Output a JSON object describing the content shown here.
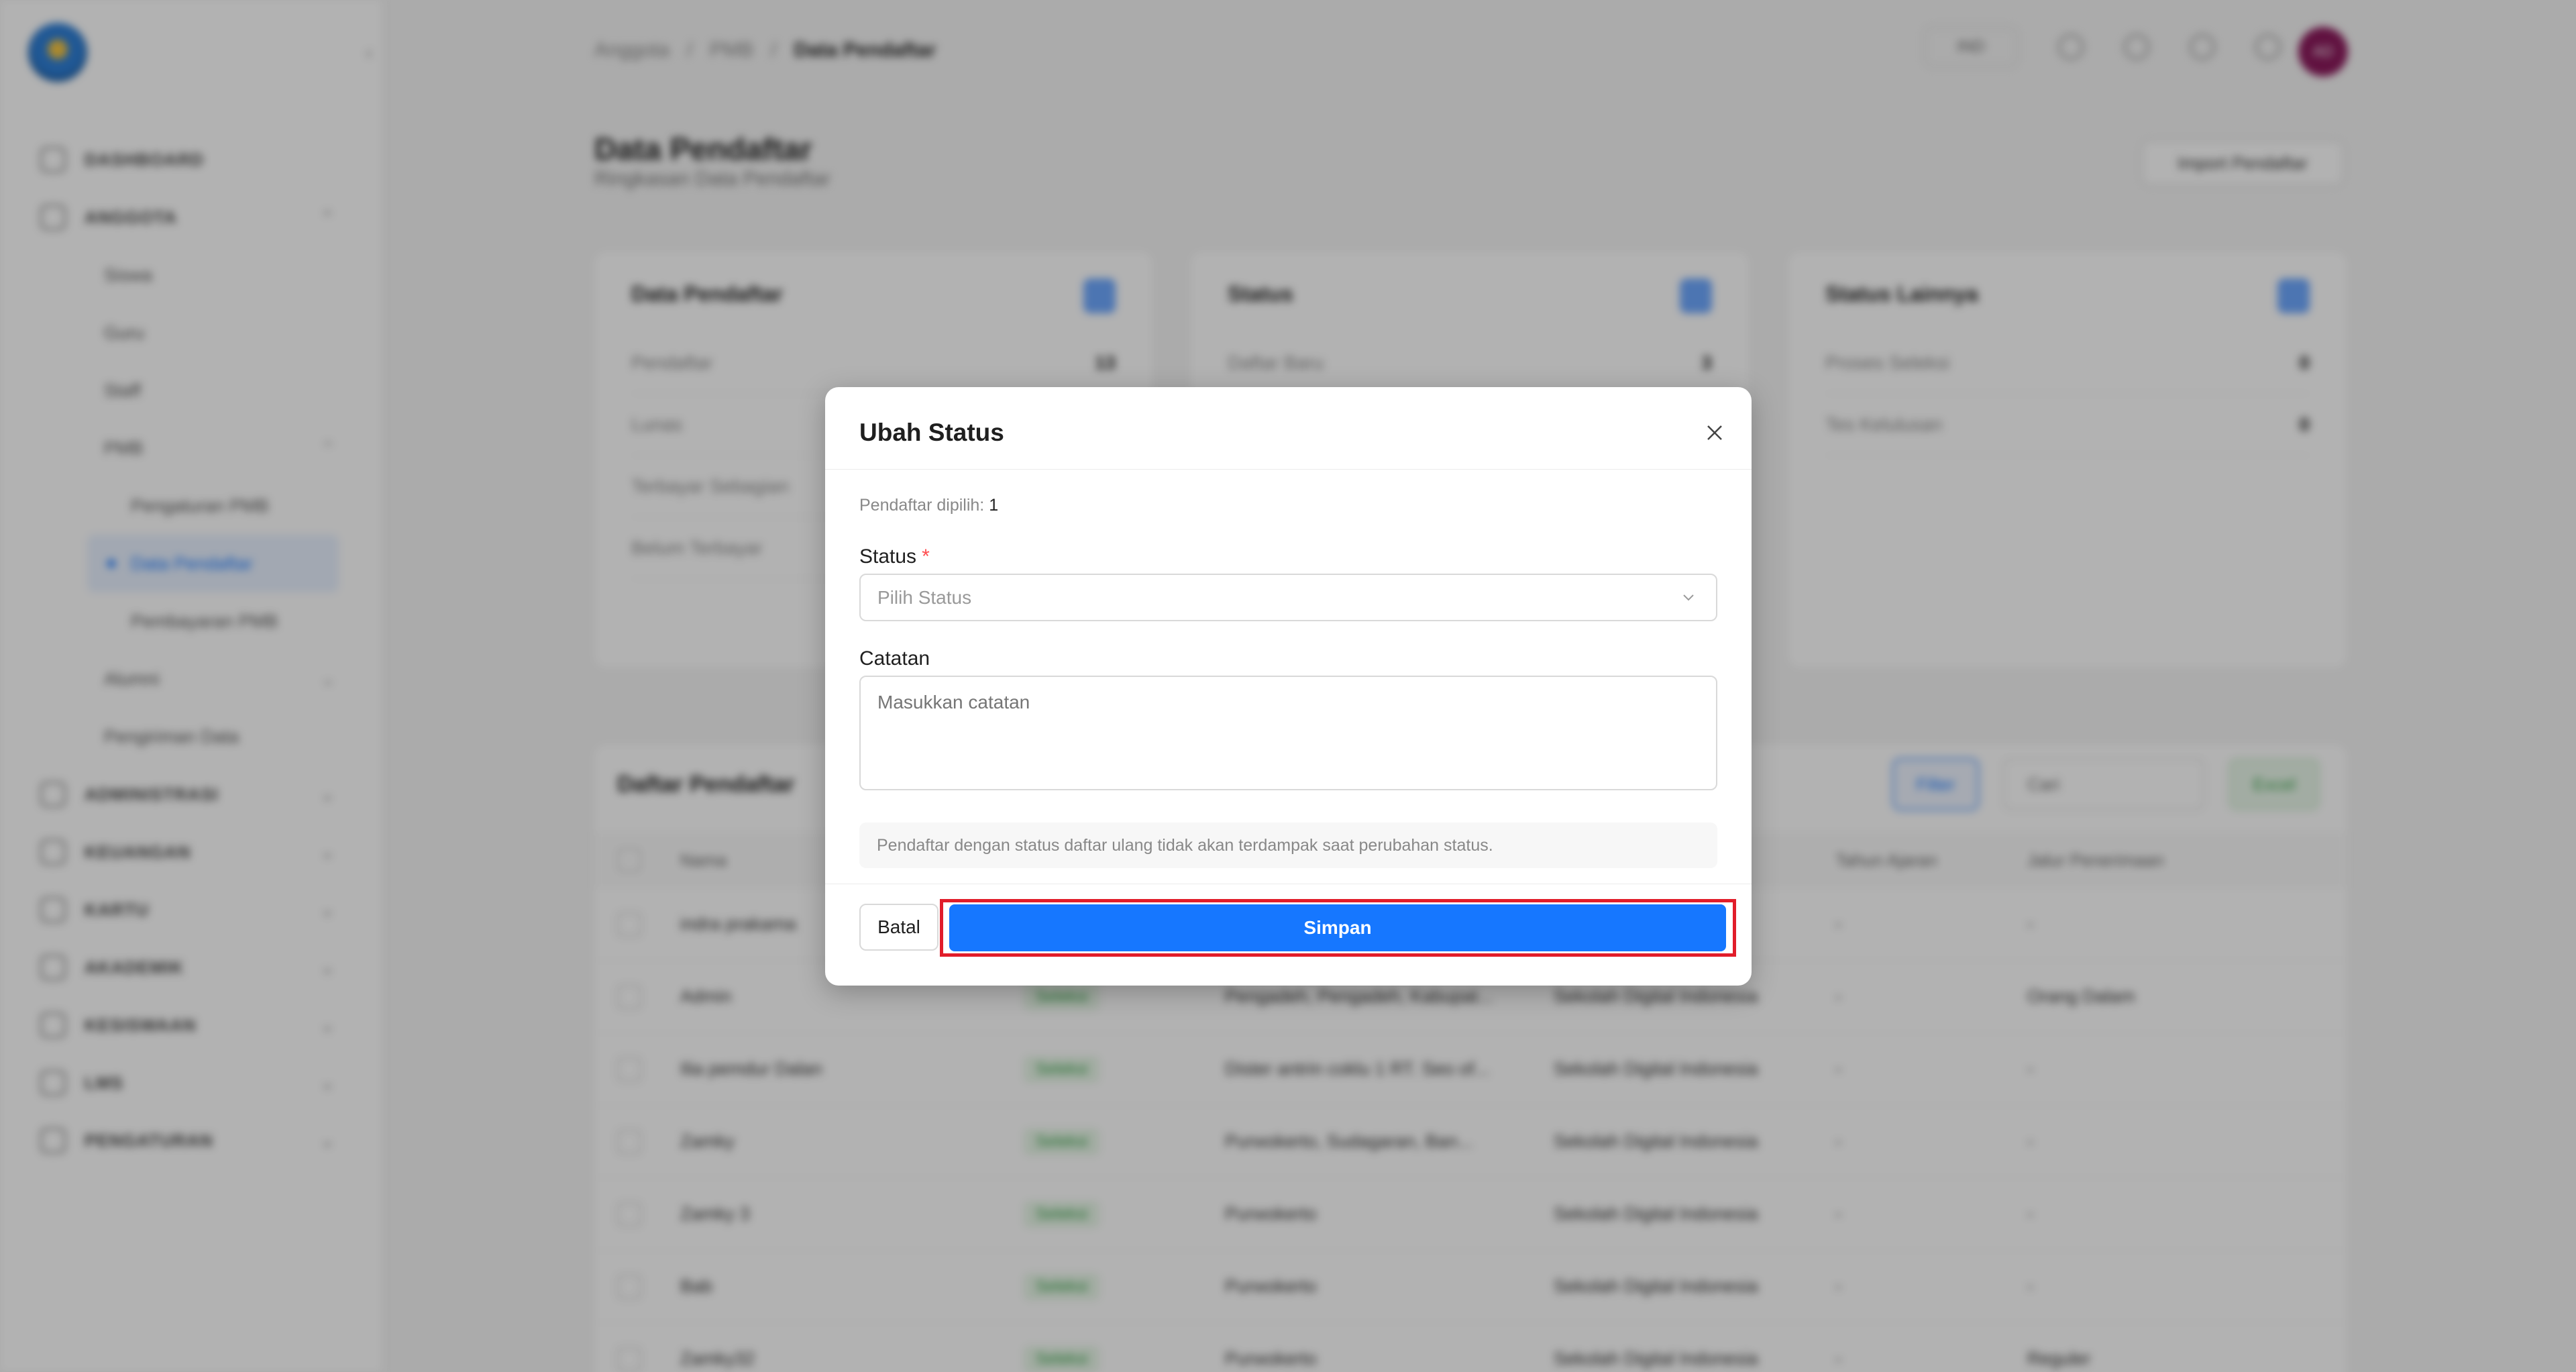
{
  "sidebar": {
    "logo_icon": "tut-wuri-handayani-logo",
    "nav": [
      {
        "label": "DASHBOARD",
        "icon": "dashboard-icon"
      },
      {
        "label": "ANGGOTA",
        "icon": "users-icon"
      },
      {
        "label": "ADMINISTRASI",
        "icon": "file-icon"
      },
      {
        "label": "KEUANGAN",
        "icon": "wallet-icon"
      },
      {
        "label": "KARTU",
        "icon": "card-icon"
      },
      {
        "label": "AKADEMIK",
        "icon": "book-icon"
      },
      {
        "label": "KESISWAAN",
        "icon": "student-icon"
      },
      {
        "label": "LMS",
        "icon": "monitor-icon"
      },
      {
        "label": "PENGATURAN",
        "icon": "gear-icon"
      }
    ],
    "anggota_sub": [
      "Siswa",
      "Guru",
      "Staff",
      "PMB"
    ],
    "pmb_sub": [
      "Pengaturan PMB",
      "Data Pendaftar",
      "Pembayaran PMB"
    ],
    "anggota_sub2": [
      "Alumni",
      "Pengiriman Data"
    ]
  },
  "header": {
    "breadcrumb": [
      "Anggota",
      "/",
      "PMB",
      "/",
      "Data Pendaftar"
    ],
    "lang": "IND",
    "avatar_initials": "AD"
  },
  "page": {
    "title": "Data Pendaftar",
    "subtitle": "Ringkasan Data Pendaftar",
    "import_label": "Import Pendaftar"
  },
  "cards": [
    {
      "title": "Data Pendaftar",
      "rows": [
        [
          "Pendaftar",
          "13"
        ],
        [
          "Lunas",
          ""
        ],
        [
          "Terbayar Sebagian",
          ""
        ],
        [
          "Belum Terbayar",
          ""
        ]
      ]
    },
    {
      "title": "Status",
      "rows": [
        [
          "Daftar Baru",
          "3"
        ]
      ]
    },
    {
      "title": "Status Lainnya",
      "rows": [
        [
          "Proses Seleksi",
          "0"
        ],
        [
          "Tes Kelulusan",
          "0"
        ]
      ]
    }
  ],
  "table": {
    "title": "Daftar Pendaftar",
    "filter_label": "Filter",
    "search_placeholder": "Cari",
    "export_label": "Excel",
    "headers": [
      "Nama",
      "Tahun Ajaran",
      "Jalur Penerimaan"
    ],
    "rows": [
      {
        "name": "indra prakama",
        "badge": "",
        "addr": "",
        "school": "",
        "c5": "-",
        "c6": "-"
      },
      {
        "name": "Admin",
        "badge": "Seleksi",
        "addr": "Pengadeh, Pengadeh, Kabupat...",
        "school": "Sekolah Digital Indonesia",
        "c5": "-",
        "c6": "Orang Dalam"
      },
      {
        "name": "Ilia pemdur Dalan",
        "badge": "Seleksi",
        "addr": "Dister antrin coklu 1 RT. Seo of...",
        "school": "Sekolah Digital Indonesia",
        "c5": "-",
        "c6": "-"
      },
      {
        "name": "Zamky",
        "badge": "Seleksi",
        "addr": "Purwokerto, Sudagaran, Ban...",
        "school": "Sekolah Digital Indonesia",
        "c5": "-",
        "c6": "-"
      },
      {
        "name": "Zamky 3",
        "badge": "Seleksi",
        "addr": "Purwokerto",
        "school": "Sekolah Digital Indonesia",
        "c5": "-",
        "c6": "-"
      },
      {
        "name": "Bab",
        "badge": "Seleksi",
        "addr": "Purwokerto",
        "school": "Sekolah Digital Indonesia",
        "c5": "-",
        "c6": "-"
      },
      {
        "name": "Zamky32",
        "badge": "Seleksi",
        "addr": "Purwokerto",
        "school": "Sekolah Digital Indonesia",
        "c5": "-",
        "c6": "Reguler"
      }
    ]
  },
  "modal": {
    "title": "Ubah Status",
    "selected_label": "Pendaftar dipilih:",
    "selected_count": "1",
    "status_label": "Status",
    "required_mark": "*",
    "status_placeholder": "Pilih Status",
    "notes_label": "Catatan",
    "notes_placeholder": "Masukkan catatan",
    "notice": "Pendaftar dengan status daftar ulang tidak akan terdampak saat perubahan status.",
    "cancel_label": "Batal",
    "save_label": "Simpan",
    "close_icon": "close-icon"
  },
  "colors": {
    "primary": "#1677ff",
    "highlight": "#e11d2a",
    "danger": "#ff4d4f"
  }
}
